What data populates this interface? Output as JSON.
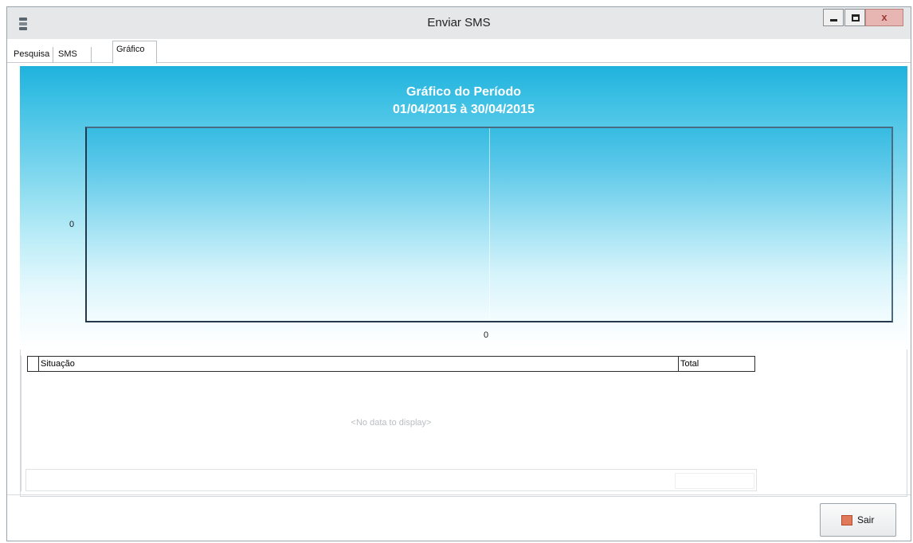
{
  "window": {
    "title": "Enviar SMS",
    "close_glyph": "x"
  },
  "tabs": [
    {
      "label": "Pesquisa"
    },
    {
      "label": "SMS"
    },
    {
      "label": "Gráfico",
      "selected": true
    }
  ],
  "chart": {
    "title_line1": "Gráfico do Período",
    "title_line2": "01/04/2015 à 30/04/2015",
    "y_tick": "0",
    "x_tick": "0",
    "colors": {
      "top": "#1fb2dd",
      "bottom": "#ffffff",
      "title": "#ffffff"
    }
  },
  "chart_data": {
    "type": "bar",
    "title": "Gráfico do Período",
    "subtitle": "01/04/2015 à 30/04/2015",
    "categories": [],
    "values": [],
    "y_ticks": [
      "0"
    ],
    "x_ticks": [
      "0"
    ],
    "grid": false
  },
  "grid": {
    "columns": [
      "Situação",
      "Total"
    ],
    "rows": [],
    "empty_text": "<No data to display>"
  },
  "buttons": {
    "sair": "Sair"
  },
  "icons": {
    "app": "sms-app-icon",
    "sair": "exit-icon"
  }
}
